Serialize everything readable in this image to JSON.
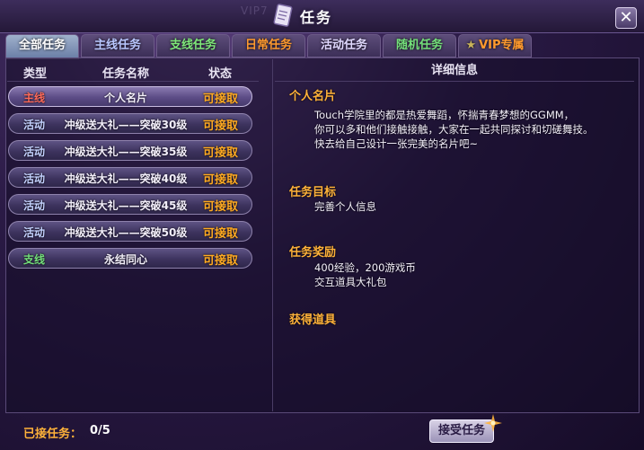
{
  "window": {
    "title": "任务",
    "background_text": "VIP7",
    "close_glyph": "✕"
  },
  "tabs": [
    {
      "label": "全部任务",
      "color": "#ffffff",
      "active": true
    },
    {
      "label": "主线任务",
      "color": "#b9c7ff",
      "active": false
    },
    {
      "label": "支线任务",
      "color": "#7fe87a",
      "active": false
    },
    {
      "label": "日常任务",
      "color": "#ff9a2e",
      "active": false
    },
    {
      "label": "活动任务",
      "color": "#e0d8ff",
      "active": false
    },
    {
      "label": "随机任务",
      "color": "#74e07b",
      "active": false
    },
    {
      "label": "VIP专属",
      "color": "#ff9a2e",
      "active": false,
      "icon": "star-icon"
    }
  ],
  "list": {
    "headers": {
      "type": "类型",
      "name": "任务名称",
      "status": "状态"
    },
    "rows": [
      {
        "type": "主线",
        "type_color": "#ff6a5a",
        "name": "个人名片",
        "status": "可接取",
        "selected": true
      },
      {
        "type": "活动",
        "type_color": "#c4d2ff",
        "name": "冲级送大礼——突破30级",
        "status": "可接取",
        "selected": false
      },
      {
        "type": "活动",
        "type_color": "#c4d2ff",
        "name": "冲级送大礼——突破35级",
        "status": "可接取",
        "selected": false
      },
      {
        "type": "活动",
        "type_color": "#c4d2ff",
        "name": "冲级送大礼——突破40级",
        "status": "可接取",
        "selected": false
      },
      {
        "type": "活动",
        "type_color": "#c4d2ff",
        "name": "冲级送大礼——突破45级",
        "status": "可接取",
        "selected": false
      },
      {
        "type": "活动",
        "type_color": "#c4d2ff",
        "name": "冲级送大礼——突破50级",
        "status": "可接取",
        "selected": false
      },
      {
        "type": "支线",
        "type_color": "#74e07b",
        "name": "永结同心",
        "status": "可接取",
        "selected": false
      }
    ]
  },
  "detail": {
    "header": "详细信息",
    "name_title": "个人名片",
    "description": [
      "Touch学院里的都是热爱舞蹈，怀揣青春梦想的GGMM，",
      "你可以多和他们接触接触，大家在一起共同探讨和切磋舞技。",
      "快去给自己设计一张完美的名片吧~"
    ],
    "goal_title": "任务目标",
    "goal_text": "完善个人信息",
    "reward_title": "任务奖励",
    "reward_lines": [
      "400经验，200游戏币",
      "交互道具大礼包"
    ],
    "items_title": "获得道具"
  },
  "footer": {
    "accepted_label": "已接任务：",
    "accepted_value": "0/5",
    "accept_button": "接受任务"
  }
}
